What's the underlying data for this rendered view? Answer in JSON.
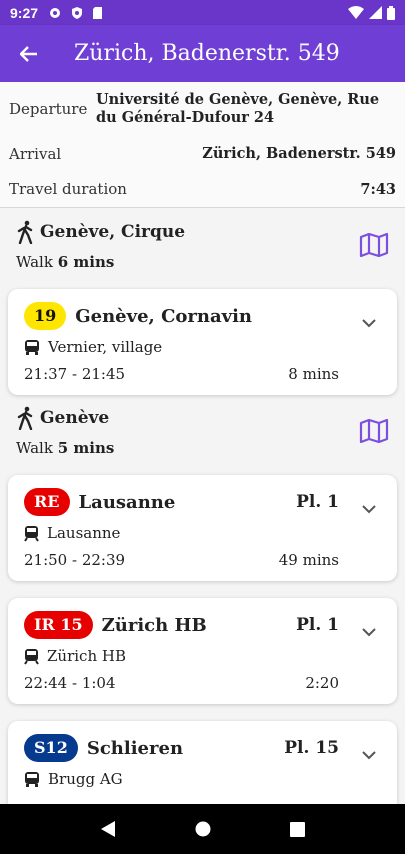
{
  "status": {
    "time": "9:27"
  },
  "header": {
    "title": "Zürich, Badenerstr. 549"
  },
  "summary": {
    "departure_label": "Departure",
    "departure_value": "Université de Genève, Genève, Rue du Général-Dufour 24",
    "arrival_label": "Arrival",
    "arrival_value": "Zürich, Badenerstr. 549",
    "duration_label": "Travel duration",
    "duration_value": "7:43"
  },
  "legs": [
    {
      "kind": "walk",
      "destination": "Genève, Cirque",
      "walk_label": "Walk",
      "duration": "6 mins"
    },
    {
      "kind": "ride",
      "line": "19",
      "line_style": "tram",
      "destination": "Genève, Cornavin",
      "platform": "",
      "direction_icon": "bus-icon",
      "direction": "Vernier, village",
      "time_range": "21:37 - 21:45",
      "duration": "8 mins"
    },
    {
      "kind": "walk",
      "destination": "Genève",
      "walk_label": "Walk",
      "duration": "5 mins"
    },
    {
      "kind": "ride",
      "line": "RE",
      "line_style": "re",
      "destination": "Lausanne",
      "platform": "Pl. 1",
      "direction_icon": "train-icon",
      "direction": "Lausanne",
      "time_range": "21:50 - 22:39",
      "duration": "49 mins"
    },
    {
      "kind": "ride",
      "line": "IR 15",
      "line_style": "re",
      "destination": "Zürich HB",
      "platform": "Pl. 1",
      "direction_icon": "train-icon",
      "direction": "Zürich HB",
      "time_range": "22:44 - 1:04",
      "duration": "2:20"
    },
    {
      "kind": "ride",
      "line": "S12",
      "line_style": "sbahn",
      "destination": "Schlieren",
      "platform": "Pl. 15",
      "direction_icon": "bus-icon",
      "direction": "Brugg AG",
      "time_range": "",
      "duration": ""
    }
  ],
  "colors": {
    "primary": "#6f3ed5",
    "status_bar": "#6a36c9",
    "accent": "#7b4fe0"
  }
}
